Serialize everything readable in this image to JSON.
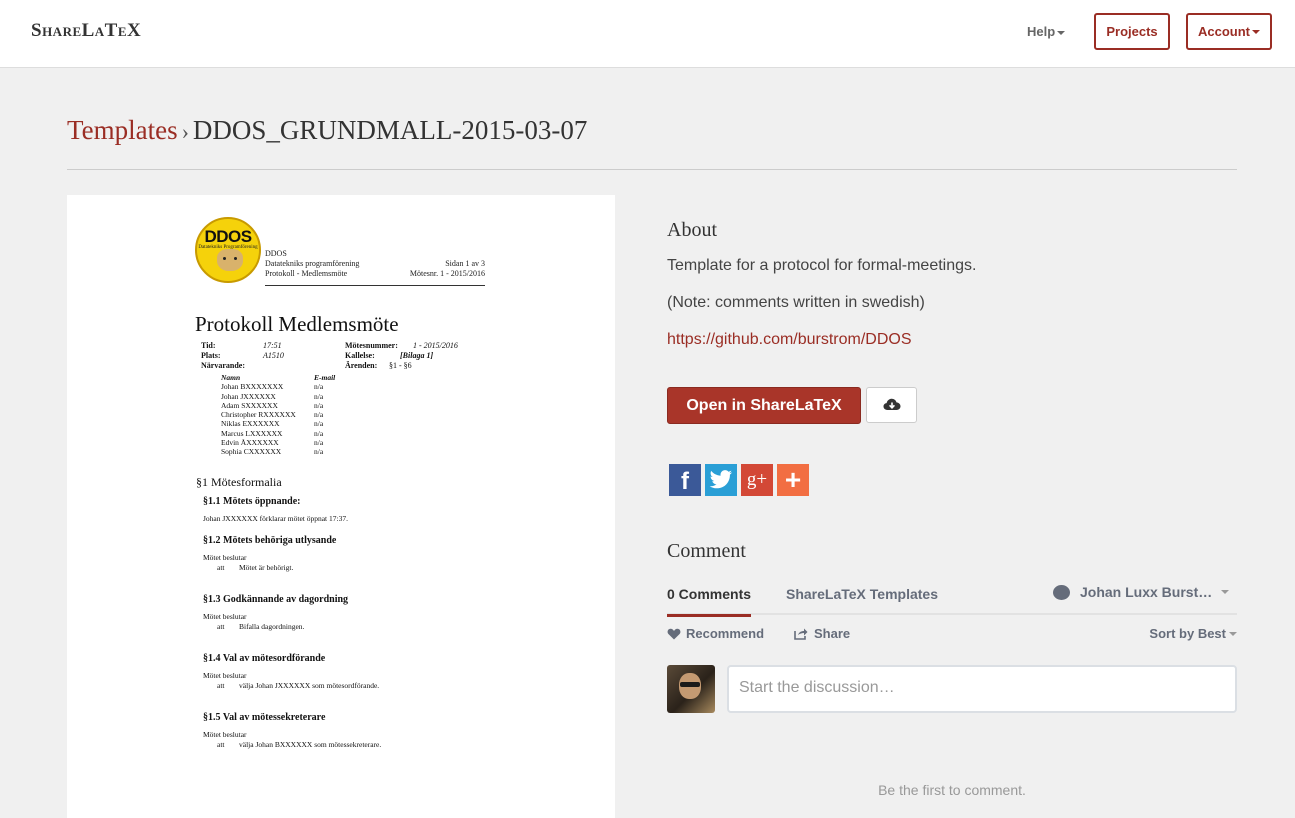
{
  "navbar": {
    "brand": "ShareLaTeX",
    "help": "Help",
    "projects": "Projects",
    "account": "Account"
  },
  "breadcrumb": {
    "templates": "Templates",
    "separator": "›",
    "current": "DDOS_GRUNDMALL-2015-03-07"
  },
  "preview": {
    "logo_text": "DDOS",
    "logo_subtext": "Datatekniks Programförening",
    "header_lines": [
      "DDOS",
      "Datatekniks programförening",
      "Protokoll - Medlemsmöte"
    ],
    "header_right": [
      "Sidan 1 av 3",
      "Mötesnr. 1 - 2015/2016"
    ],
    "title": "Protokoll Medlemsmöte",
    "meta_left": {
      "tid_label": "Tid:",
      "tid_value": "17:51",
      "plats_label": "Plats:",
      "plats_value": "A1510",
      "narvarande_label": "Närvarande:"
    },
    "meta_right": {
      "motesnummer_label": "Mötesnummer:",
      "motesnummer_value": "1 - 2015/2016",
      "kallelse_label": "Kallelse:",
      "kallelse_value": "[Bilaga 1]",
      "arenden_label": "Ärenden:",
      "arenden_value": "§1 - §6"
    },
    "attendee_headers": [
      "Namn",
      "E-mail"
    ],
    "attendees": [
      {
        "name": "Johan BXXXXXXX",
        "email": "n/a"
      },
      {
        "name": "Johan JXXXXXX",
        "email": "n/a"
      },
      {
        "name": "Adam SXXXXXX",
        "email": "n/a"
      },
      {
        "name": "Christopher RXXXXXX",
        "email": "n/a"
      },
      {
        "name": "Niklas EXXXXXX",
        "email": "n/a"
      },
      {
        "name": "Marcus LXXXXXX",
        "email": "n/a"
      },
      {
        "name": "Edvin ÅXXXXXX",
        "email": "n/a"
      },
      {
        "name": "Sophia CXXXXXX",
        "email": "n/a"
      }
    ],
    "section1": "§1 Mötesformalia",
    "s11_title": "§1.1 Mötets öppnande:",
    "s11_text": "Johan JXXXXXX förklarar mötet öppnat 17:37.",
    "s12_title": "§1.2 Mötets behöriga utlysande",
    "s12_l1": "Mötet beslutar",
    "s12_att": "att",
    "s12_l2": "Mötet är behörigt.",
    "s13_title": "§1.3 Godkännande av dagordning",
    "s13_l1": "Mötet beslutar",
    "s13_att": "att",
    "s13_l2": "Bifalla dagordningen.",
    "s14_title": "§1.4 Val av mötesordförande",
    "s14_l1": "Mötet beslutar",
    "s14_att": "att",
    "s14_l2": "välja Johan JXXXXXX som mötesordförande.",
    "s15_title": "§1.5 Val av mötessekreterare",
    "s15_l1": "Mötet beslutar",
    "s15_att": "att",
    "s15_l2": "välja Johan BXXXXXX som mötessekreterare."
  },
  "about": {
    "heading": "About",
    "description": "Template for a protocol for formal-meetings.",
    "note": "(Note: comments written in swedish)",
    "link": "https://github.com/burstrom/DDOS",
    "open_button": "Open in ShareLaTeX",
    "download_icon": "cloud-download-icon"
  },
  "social": {
    "facebook": "f",
    "twitter_icon": "twitter-icon",
    "googleplus": "g+",
    "add": "+"
  },
  "comments": {
    "heading": "Comment",
    "count_tab": "0 Comments",
    "community_tab": "ShareLaTeX Templates",
    "user": "Johan Luxx Burst…",
    "recommend": "Recommend",
    "share": "Share",
    "sort": "Sort by Best",
    "placeholder": "Start the discussion…",
    "empty": "Be the first to comment."
  },
  "colors": {
    "brand_red": "#9a2d24",
    "button_red": "#a93529",
    "facebook": "#3b5998",
    "twitter": "#2a9fd6",
    "googleplus": "#d34836",
    "addthis": "#f26e42"
  }
}
